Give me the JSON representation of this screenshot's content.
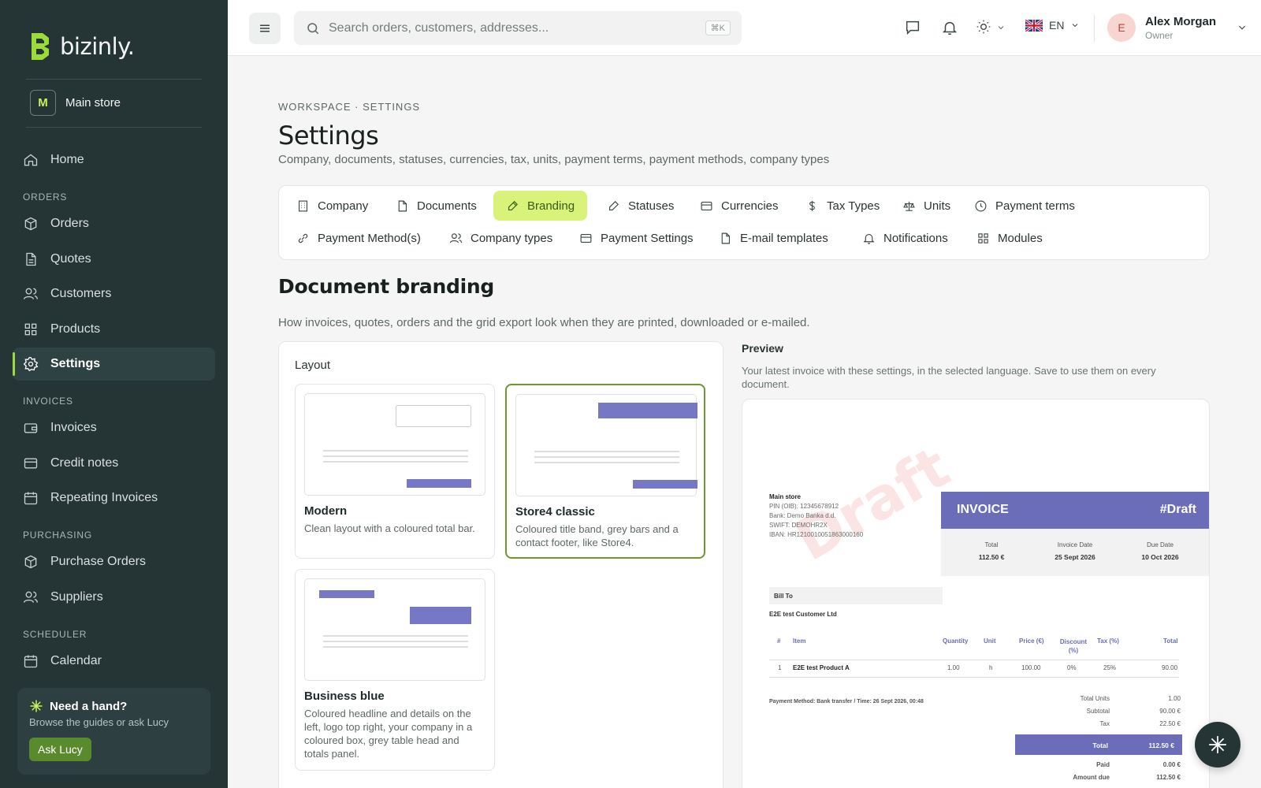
{
  "brand": {
    "name": "bizinly.",
    "accent": "#9bdc3a"
  },
  "store": {
    "initial": "M",
    "name": "Main store"
  },
  "sidebar": {
    "home": "Home",
    "sections": {
      "orders": "ORDERS",
      "invoices": "INVOICES",
      "purchasing": "PURCHASING",
      "scheduler": "SCHEDULER"
    },
    "items": {
      "orders": "Orders",
      "quotes": "Quotes",
      "customers": "Customers",
      "products": "Products",
      "settings": "Settings",
      "invoices": "Invoices",
      "credit_notes": "Credit notes",
      "repeating": "Repeating Invoices",
      "purchase_orders": "Purchase Orders",
      "suppliers": "Suppliers",
      "calendar": "Calendar"
    },
    "help": {
      "title": "Need a hand?",
      "subtitle": "Browse the guides or ask Lucy",
      "button": "Ask Lucy"
    }
  },
  "topbar": {
    "search_placeholder": "Search orders, customers, addresses...",
    "shortcut": "⌘K",
    "language": "EN",
    "user": {
      "initial": "E",
      "name": "Alex Morgan",
      "role": "Owner"
    }
  },
  "page": {
    "breadcrumb": "WORKSPACE · SETTINGS",
    "title": "Settings",
    "subtitle": "Company, documents, statuses, currencies, tax, units, payment terms, payment methods, company types"
  },
  "tabs": {
    "company": "Company",
    "documents": "Documents",
    "branding": "Branding",
    "statuses": "Statuses",
    "currencies": "Currencies",
    "tax_types": "Tax Types",
    "units": "Units",
    "payment_terms": "Payment terms",
    "payment_methods": "Payment Method(s)",
    "company_types": "Company types",
    "payment_settings": "Payment Settings",
    "email_templates": "E-mail templates",
    "notifications": "Notifications",
    "modules": "Modules"
  },
  "branding": {
    "title": "Document branding",
    "subtitle": "How invoices, quotes, orders and the grid export look when they are printed, downloaded or e-mailed.",
    "layout_label": "Layout",
    "options": {
      "modern": {
        "name": "Modern",
        "desc": "Clean layout with a coloured total bar."
      },
      "store4": {
        "name": "Store4 classic",
        "desc": "Coloured title band, grey bars and a contact footer, like Store4."
      },
      "business": {
        "name": "Business blue",
        "desc": "Coloured headline and details on the left, logo top right, your company in a coloured box, grey table head and totals panel."
      }
    },
    "selected": "store4"
  },
  "preview": {
    "label": "Preview",
    "subtitle": "Your latest invoice with these settings, in the selected language. Save to use them on every document.",
    "watermark": "Draft",
    "invoice": {
      "from": {
        "name": "Main store",
        "pin": "PIN (OIB): 12345678912",
        "bank": "Bank: Demo Banka d.d.",
        "swift": "SWIFT: DEMOHR2X",
        "iban": "IBAN: HR1210010051863000160"
      },
      "title": "INVOICE",
      "number": "#Draft",
      "meta": [
        {
          "label": "Total",
          "value": "112.50 €"
        },
        {
          "label": "Invoice Date",
          "value": "25 Sept 2026"
        },
        {
          "label": "Due Date",
          "value": "10 Oct 2026"
        }
      ],
      "bill_to_label": "Bill To",
      "bill_to": "E2E test Customer Ltd",
      "columns": {
        "num": "#",
        "item": "Item",
        "qty": "Quantity",
        "unit": "Unit",
        "price": "Price (€)",
        "discount": "Discount (%)",
        "tax": "Tax (%)",
        "total": "Total"
      },
      "rows": [
        {
          "num": "1",
          "item": "E2E test Product A",
          "qty": "1.00",
          "unit": "h",
          "price": "100.00",
          "discount": "0%",
          "tax": "25%",
          "total": "90.00"
        }
      ],
      "payment_line": "Payment Method: Bank transfer  / Time: 26 Sept 2026, 00:48",
      "totals": {
        "units_label": "Total Units",
        "units": "1.00",
        "subtotal_label": "Subtotal",
        "subtotal": "90.00 €",
        "tax_label": "Tax",
        "tax": "22.50 €",
        "total_label": "Total",
        "total": "112.50 €",
        "paid_label": "Paid",
        "paid": "0.00 €",
        "due_label": "Amount due",
        "due": "112.50 €"
      }
    }
  }
}
